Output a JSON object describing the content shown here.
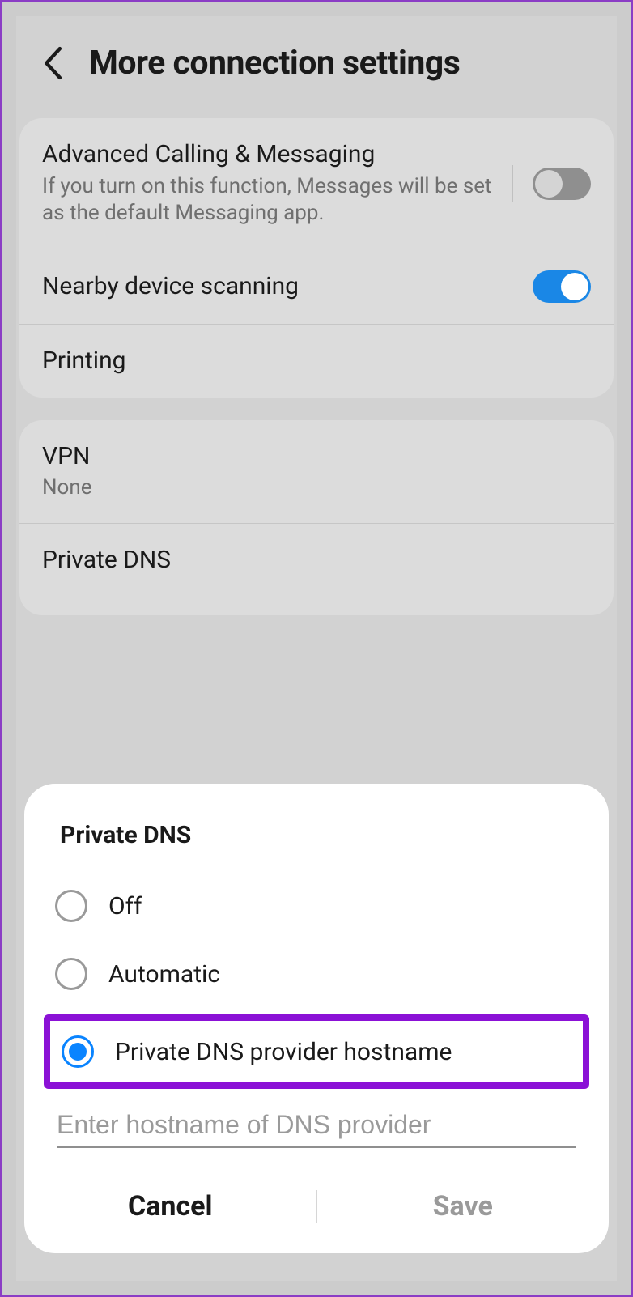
{
  "header": {
    "title": "More connection settings"
  },
  "sections": {
    "advCalling": {
      "label": "Advanced Calling & Messaging",
      "sub": "If you turn on this function, Messages will be set as the default Messaging app.",
      "on": false
    },
    "nearby": {
      "label": "Nearby device scanning",
      "on": true
    },
    "printing": {
      "label": "Printing"
    },
    "vpn": {
      "label": "VPN",
      "sub": "None"
    },
    "privateDns": {
      "label": "Private DNS"
    }
  },
  "dialog": {
    "title": "Private DNS",
    "options": {
      "off": "Off",
      "auto": "Automatic",
      "hostname": "Private DNS provider hostname"
    },
    "selected": "hostname",
    "input_placeholder": "Enter hostname of DNS provider",
    "input_value": "",
    "cancel": "Cancel",
    "save": "Save"
  }
}
